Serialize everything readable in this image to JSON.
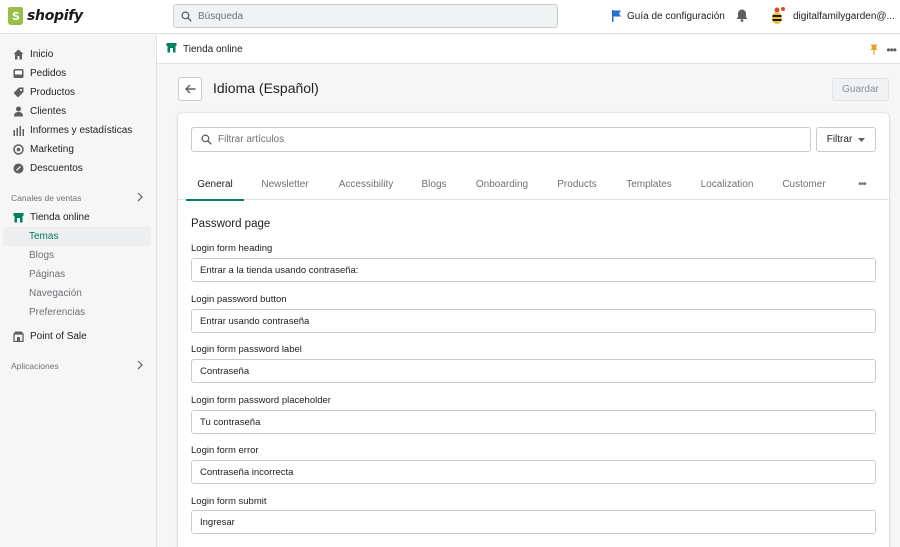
{
  "topbar": {
    "logo_text": "shopify",
    "search_placeholder": "Búsqueda",
    "guide_label": "Guía de configuración",
    "account_name": "digitalfamilygarden@..."
  },
  "sidebar": {
    "items": [
      {
        "label": "Inicio",
        "icon": "home-icon"
      },
      {
        "label": "Pedidos",
        "icon": "orders-icon"
      },
      {
        "label": "Productos",
        "icon": "tag-icon"
      },
      {
        "label": "Clientes",
        "icon": "person-icon"
      },
      {
        "label": "Informes y estadísticas",
        "icon": "bar-chart-icon"
      },
      {
        "label": "Marketing",
        "icon": "target-icon"
      },
      {
        "label": "Descuentos",
        "icon": "discount-icon"
      }
    ],
    "sales_channels_header": "Canales de ventas",
    "online_store": "Tienda online",
    "online_store_subitems": [
      "Temas",
      "Blogs",
      "Páginas",
      "Navegación",
      "Preferencias"
    ],
    "point_of_sale": "Point of Sale",
    "apps_header": "Aplicaciones"
  },
  "breadcrumb": {
    "store_label": "Tienda online"
  },
  "page": {
    "title": "Idioma (Español)",
    "save_label": "Guardar",
    "filter_placeholder": "Filtrar artículos",
    "filter_button": "Filtrar"
  },
  "tabs": [
    "General",
    "Newsletter",
    "Accessibility",
    "Blogs",
    "Onboarding",
    "Products",
    "Templates",
    "Localization",
    "Customer"
  ],
  "tabs_more": "•••",
  "form": {
    "section_title": "Password page",
    "fields": [
      {
        "label": "Login form heading",
        "value": "Entrar a la tienda usando contraseña:"
      },
      {
        "label": "Login password button",
        "value": "Entrar usando contraseña"
      },
      {
        "label": "Login form password label",
        "value": "Contraseña"
      },
      {
        "label": "Login form password placeholder",
        "value": "Tu contraseña"
      },
      {
        "label": "Login form error",
        "value": "Contraseña incorrecta"
      },
      {
        "label": "Login form submit",
        "value": "Ingresar"
      }
    ]
  },
  "colors": {
    "accent_green": "#008060",
    "active_subitem": "#007a5c",
    "logo_green": "#95bf47"
  }
}
